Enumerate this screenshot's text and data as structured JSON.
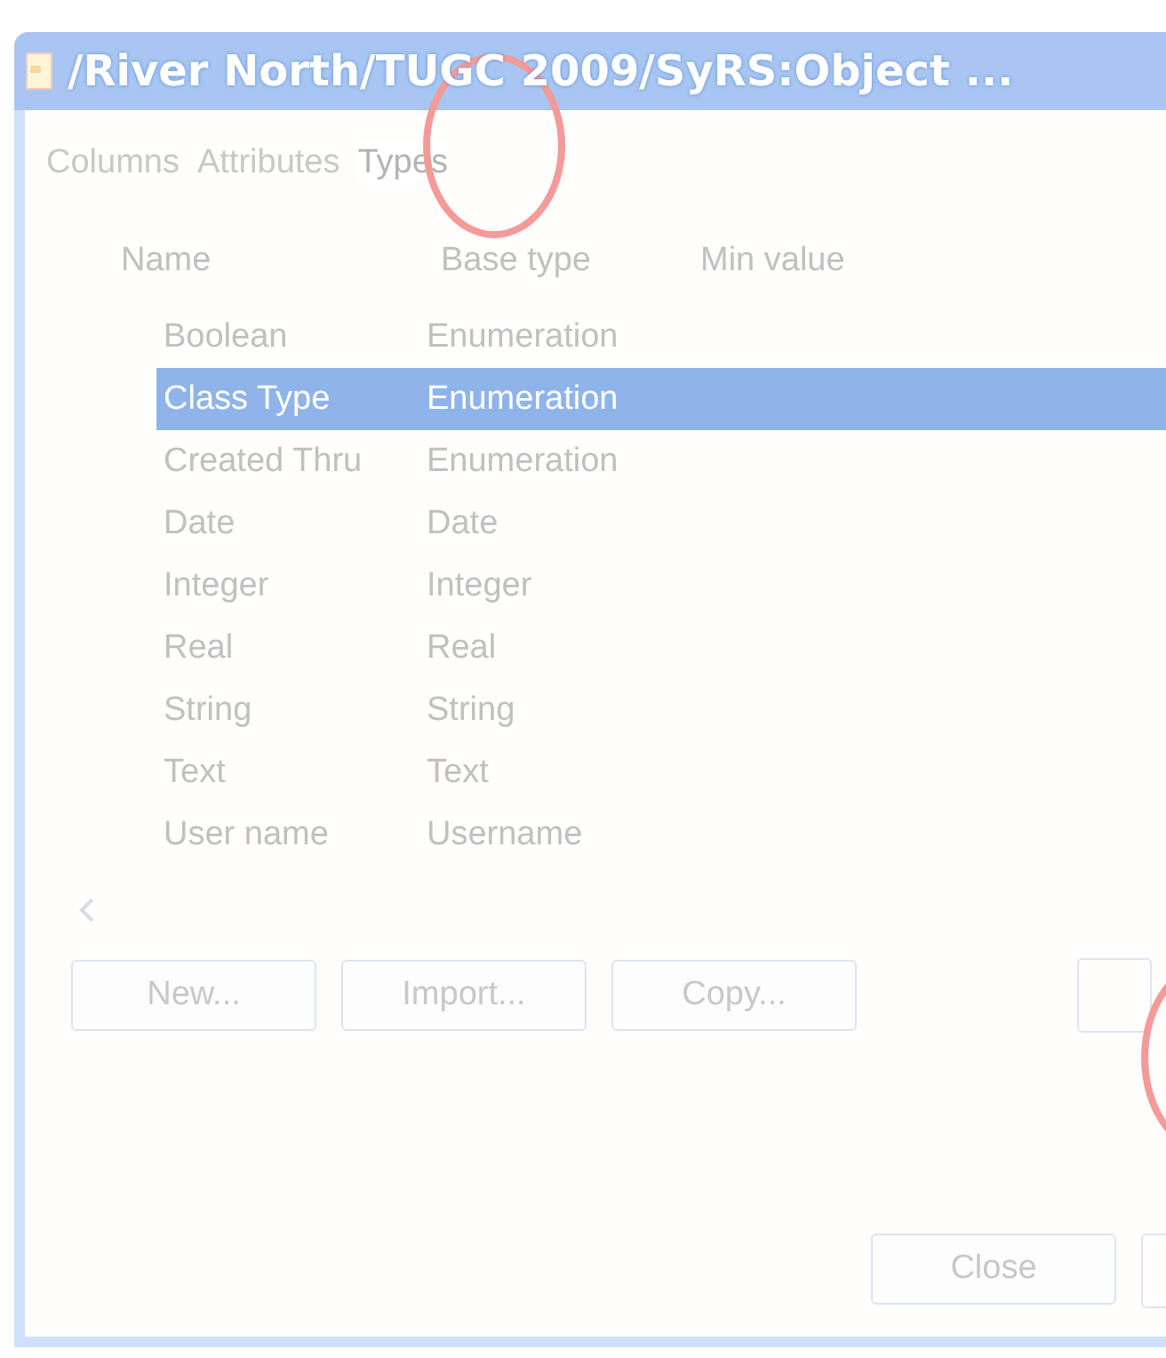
{
  "window": {
    "title": "/River North/TUGC  2009/SyRS:Object ..."
  },
  "tabs": [
    {
      "label": "Columns",
      "selected": false
    },
    {
      "label": "Attributes",
      "selected": false
    },
    {
      "label": "Types",
      "selected": true
    }
  ],
  "table": {
    "columns": [
      "Name",
      "Base type",
      "Min value"
    ],
    "rows": [
      {
        "name": "Boolean",
        "base_type": "Enumeration",
        "selected": false
      },
      {
        "name": "Class Type",
        "base_type": "Enumeration",
        "selected": true
      },
      {
        "name": "Created Thru",
        "base_type": "Enumeration",
        "selected": false
      },
      {
        "name": "Date",
        "base_type": "Date",
        "selected": false
      },
      {
        "name": "Integer",
        "base_type": "Integer",
        "selected": false
      },
      {
        "name": "Real",
        "base_type": "Real",
        "selected": false
      },
      {
        "name": "String",
        "base_type": "String",
        "selected": false
      },
      {
        "name": "Text",
        "base_type": "Text",
        "selected": false
      },
      {
        "name": "User name",
        "base_type": "Username",
        "selected": false
      }
    ]
  },
  "buttons": [
    "New...",
    "Import...",
    "Copy..."
  ],
  "footer_buttons": [
    "Close"
  ]
}
